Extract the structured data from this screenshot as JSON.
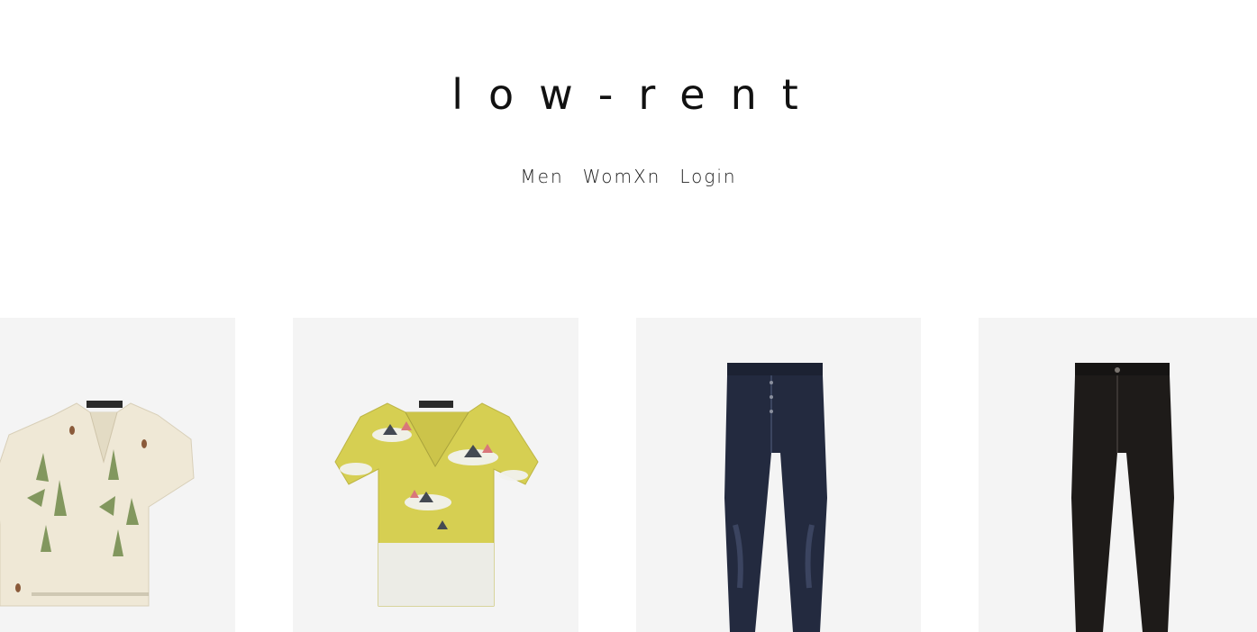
{
  "header": {
    "brand": "low-rent"
  },
  "nav": {
    "items": [
      {
        "label": "Men"
      },
      {
        "label": "WomXn"
      },
      {
        "label": "Login"
      }
    ]
  },
  "products": [
    {
      "name": "cream-botanical-print-camp-shirt",
      "color": "#efe8d6"
    },
    {
      "name": "yellow-landscape-print-camp-shirt",
      "color": "#d6cf52"
    },
    {
      "name": "dark-indigo-skinny-jeans",
      "color": "#232a3f"
    },
    {
      "name": "black-skinny-jeans",
      "color": "#1e1b19"
    }
  ],
  "colors": {
    "background": "#ffffff",
    "card_background": "#f4f4f4",
    "text": "#111111"
  }
}
